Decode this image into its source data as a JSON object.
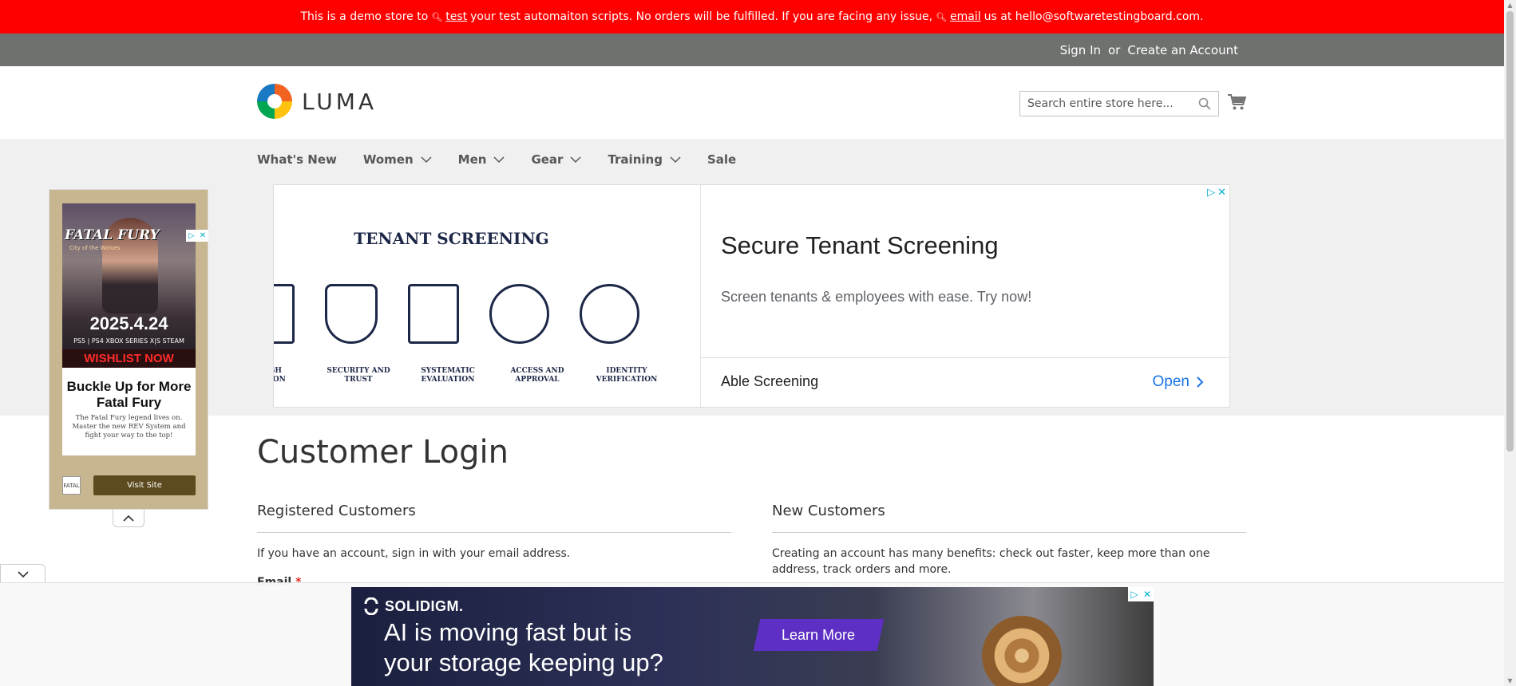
{
  "demo_banner": {
    "text_1": "This is a demo store to",
    "link_test": "test",
    "text_2": "your test automaiton scripts. No orders will be fulfilled. If you are facing any issue,",
    "link_email": "email",
    "text_3": "us at hello@softwaretestingboard.com."
  },
  "panel": {
    "sign_in": "Sign In",
    "or": "or",
    "create_account": "Create an Account"
  },
  "header": {
    "logo_text": "LUMA",
    "search_placeholder": "Search entire store here..."
  },
  "nav": {
    "items": [
      {
        "label": "What's New",
        "dropdown": false
      },
      {
        "label": "Women",
        "dropdown": true
      },
      {
        "label": "Men",
        "dropdown": true
      },
      {
        "label": "Gear",
        "dropdown": true
      },
      {
        "label": "Training",
        "dropdown": true
      },
      {
        "label": "Sale",
        "dropdown": false
      }
    ]
  },
  "side_ad": {
    "game_title": "FATAL FURY",
    "game_subtitle": "City of the Wolves",
    "date": "2025.4.24",
    "platforms": "PS5 | PS4  XBOX SERIES X|S  STEAM",
    "wishlist": "WISHLIST NOW",
    "card_title": "Buckle Up for More Fatal Fury",
    "card_body": "The Fatal Fury legend lives on. Master the new REV System and fight your way to the top!",
    "visit_label": "Visit Site",
    "logo_text": "FATAL"
  },
  "tenant_ad": {
    "image_title": "TENANT SCREENING",
    "icon_labels": [
      "OUGH\nNATION",
      "SECURITY AND\nTRUST",
      "SYSTEMATIC\nEVALUATION",
      "ACCESS AND\nAPPROVAL",
      "IDENTITY\nVERIFICATION"
    ],
    "headline": "Secure Tenant Screening",
    "description": "Screen tenants & employees with ease. Try now!",
    "advertiser": "Able Screening",
    "cta": "Open"
  },
  "main": {
    "page_title": "Customer Login",
    "registered_title": "Registered Customers",
    "registered_text": "If you have an account, sign in with your email address.",
    "email_label": "Email",
    "required_mark": "*",
    "new_title": "New Customers",
    "new_text": "Creating an account has many benefits: check out faster, keep more than one address, track orders and more."
  },
  "anchor_ad": {
    "brand": "SOLIDIGM.",
    "headline_1": "AI is moving fast but is",
    "headline_2": "your storage keeping up?",
    "cta": "Learn More"
  },
  "colors": {
    "demo_banner_bg": "#ff0000",
    "panel_bg": "#6e716e",
    "nav_bg": "#f0f0f0",
    "ad_link_blue": "#1a73e8"
  }
}
